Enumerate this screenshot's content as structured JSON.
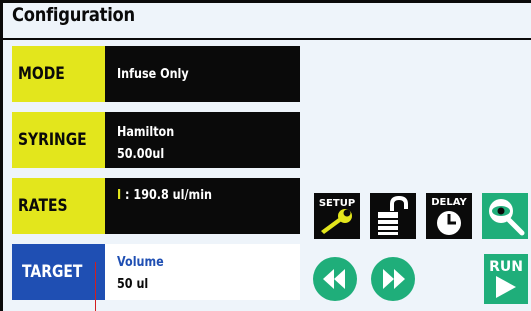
{
  "app": {
    "title": "Configuration"
  },
  "rows": {
    "mode": {
      "label": "MODE",
      "value": "Infuse Only"
    },
    "syringe": {
      "label": "SYRINGE",
      "value_line1": "Hamilton",
      "value_line2": "50.00ul"
    },
    "rates": {
      "label": "RATES",
      "indicator": "I",
      "value": " : 190.8 ul/min"
    },
    "target": {
      "label": "TARGET",
      "value_line1": "Volume",
      "value_line2": "50 ul"
    }
  },
  "toolbar": {
    "setup_label": "SETUP",
    "delay_label": "DELAY",
    "run_label": "RUN",
    "setup_icon": "wrench-icon",
    "lock_icon": "unlocked-padlock-icon",
    "delay_icon": "clock-icon",
    "view_icon": "eye-magnifier-icon",
    "rewind_icon": "rewind-icon",
    "fast_forward_icon": "fast-forward-icon",
    "run_icon": "play-icon"
  },
  "colors": {
    "label_yellow": "#e3e61c",
    "target_blue": "#1f4fb3",
    "icon_green": "#1fae7a",
    "cursor_red": "#d21f1f",
    "background": "#eef4fa"
  }
}
